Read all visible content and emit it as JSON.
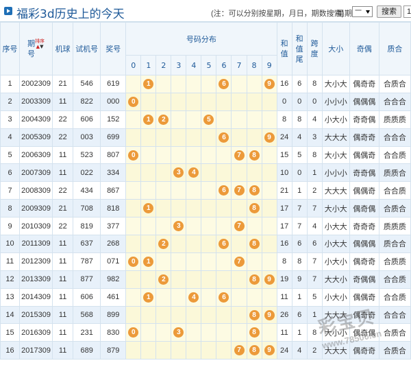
{
  "header": {
    "title": "福彩3d历史上的今天",
    "note": "(注：可以分别按星期，月日，期数搜索)",
    "week_label": "星期",
    "week_value": "一",
    "search_label": "搜索",
    "search_next": "1"
  },
  "columns": {
    "seq": "序号",
    "period_top": "期",
    "period_bottom": "号",
    "sort_label": "排序",
    "machine": "机球",
    "test": "试机号",
    "prize": "奖号",
    "dist": "号码分布",
    "digits": [
      "0",
      "1",
      "2",
      "3",
      "4",
      "5",
      "6",
      "7",
      "8",
      "9"
    ],
    "sum": "和值",
    "tail": "和值尾",
    "span": "跨度",
    "size": "大小",
    "parity": "奇偶",
    "prime": "质合"
  },
  "rows": [
    {
      "seq": "1",
      "period": "2002309",
      "machine": "21",
      "test": "546",
      "prize": "619",
      "sum": "16",
      "tail": "6",
      "span": "8",
      "size": "大小大",
      "parity": "偶奇奇",
      "prime": "合质合"
    },
    {
      "seq": "2",
      "period": "2003309",
      "machine": "11",
      "test": "822",
      "prize": "000",
      "sum": "0",
      "tail": "0",
      "span": "0",
      "size": "小小小",
      "parity": "偶偶偶",
      "prime": "合合合"
    },
    {
      "seq": "3",
      "period": "2004309",
      "machine": "22",
      "test": "606",
      "prize": "152",
      "sum": "8",
      "tail": "8",
      "span": "4",
      "size": "小大小",
      "parity": "奇奇偶",
      "prime": "质质质"
    },
    {
      "seq": "4",
      "period": "2005309",
      "machine": "22",
      "test": "003",
      "prize": "699",
      "sum": "24",
      "tail": "4",
      "span": "3",
      "size": "大大大",
      "parity": "偶奇奇",
      "prime": "合合合"
    },
    {
      "seq": "5",
      "period": "2006309",
      "machine": "11",
      "test": "523",
      "prize": "807",
      "sum": "15",
      "tail": "5",
      "span": "8",
      "size": "大小大",
      "parity": "偶偶奇",
      "prime": "合合质"
    },
    {
      "seq": "6",
      "period": "2007309",
      "machine": "11",
      "test": "022",
      "prize": "334",
      "sum": "10",
      "tail": "0",
      "span": "1",
      "size": "小小小",
      "parity": "奇奇偶",
      "prime": "质质合"
    },
    {
      "seq": "7",
      "period": "2008309",
      "machine": "22",
      "test": "434",
      "prize": "867",
      "sum": "21",
      "tail": "1",
      "span": "2",
      "size": "大大大",
      "parity": "偶偶奇",
      "prime": "合合质"
    },
    {
      "seq": "8",
      "period": "2009309",
      "machine": "21",
      "test": "708",
      "prize": "818",
      "sum": "17",
      "tail": "7",
      "span": "7",
      "size": "大小大",
      "parity": "偶奇偶",
      "prime": "合质合"
    },
    {
      "seq": "9",
      "period": "2010309",
      "machine": "22",
      "test": "819",
      "prize": "377",
      "sum": "17",
      "tail": "7",
      "span": "4",
      "size": "小大大",
      "parity": "奇奇奇",
      "prime": "质质质"
    },
    {
      "seq": "10",
      "period": "2011309",
      "machine": "11",
      "test": "637",
      "prize": "268",
      "sum": "16",
      "tail": "6",
      "span": "6",
      "size": "小大大",
      "parity": "偶偶偶",
      "prime": "质合合"
    },
    {
      "seq": "11",
      "period": "2012309",
      "machine": "11",
      "test": "787",
      "prize": "071",
      "sum": "8",
      "tail": "8",
      "span": "7",
      "size": "小大小",
      "parity": "偶奇奇",
      "prime": "合质质"
    },
    {
      "seq": "12",
      "period": "2013309",
      "machine": "11",
      "test": "877",
      "prize": "982",
      "sum": "19",
      "tail": "9",
      "span": "7",
      "size": "大大小",
      "parity": "奇偶偶",
      "prime": "合合质"
    },
    {
      "seq": "13",
      "period": "2014309",
      "machine": "11",
      "test": "606",
      "prize": "461",
      "sum": "11",
      "tail": "1",
      "span": "5",
      "size": "小大小",
      "parity": "偶偶奇",
      "prime": "合合质"
    },
    {
      "seq": "14",
      "period": "2015309",
      "machine": "11",
      "test": "568",
      "prize": "899",
      "sum": "26",
      "tail": "6",
      "span": "1",
      "size": "大大大",
      "parity": "偶奇奇",
      "prime": "合合合"
    },
    {
      "seq": "15",
      "period": "2016309",
      "machine": "11",
      "test": "231",
      "prize": "830",
      "sum": "11",
      "tail": "1",
      "span": "8",
      "size": "大小小",
      "parity": "偶奇偶",
      "prime": "合质合"
    },
    {
      "seq": "16",
      "period": "2017309",
      "machine": "11",
      "test": "689",
      "prize": "879",
      "sum": "24",
      "tail": "4",
      "span": "2",
      "size": "大大大",
      "parity": "偶奇奇",
      "prime": "合质合"
    }
  ],
  "watermark": {
    "main": "彩宝贝",
    "url": "www.78500.cn"
  }
}
